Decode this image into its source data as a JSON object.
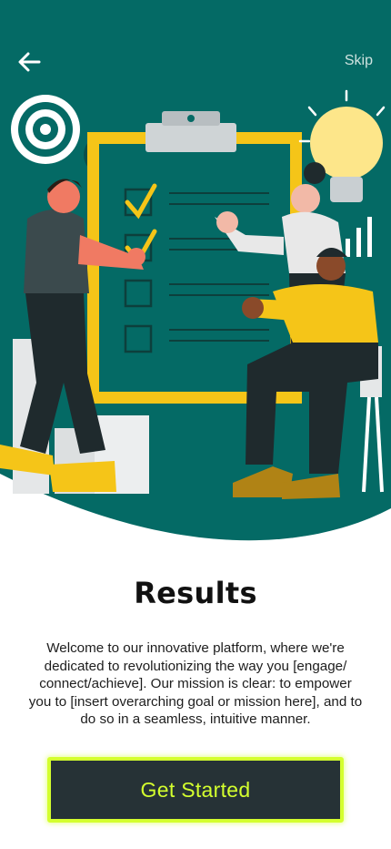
{
  "header": {
    "back_icon": "arrow-left-icon",
    "skip_label": "Skip"
  },
  "hero": {
    "illustration": "team-results-checklist-illustration"
  },
  "content": {
    "title": "Results",
    "description": "Welcome to our innovative platform, where we're dedicated to revolutionizing the way you [engage/ connect/achieve]. Our mission is clear: to empower you to [insert overarching goal or mission here], and to do so in a seamless, intuitive manner."
  },
  "cta": {
    "label": "Get Started"
  },
  "colors": {
    "hero_background": "#046a65",
    "accent": "#d4ff2e",
    "button_background": "#263236",
    "illustration_yellow": "#f5c518"
  }
}
